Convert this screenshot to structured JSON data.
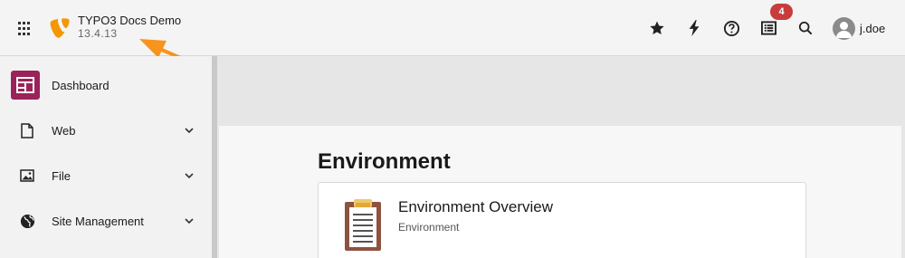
{
  "header": {
    "site_name": "TYPO3 Docs Demo",
    "site_version": "13.4.13",
    "notifications_count": "4",
    "username": "j.doe",
    "icons": [
      "apps-grid-icon",
      "typo3-logo-icon",
      "bookmark-star-icon",
      "flash-cache-icon",
      "help-icon",
      "system-information-icon",
      "search-icon",
      "avatar-icon"
    ]
  },
  "sidebar": {
    "items": [
      {
        "label": "Dashboard",
        "icon": "dashboard-icon",
        "expandable": false
      },
      {
        "label": "Web",
        "icon": "page-icon",
        "expandable": true
      },
      {
        "label": "File",
        "icon": "image-icon",
        "expandable": true
      },
      {
        "label": "Site Management",
        "icon": "globe-icon",
        "expandable": true
      }
    ]
  },
  "main": {
    "title": "Environment",
    "cards": [
      {
        "title": "Environment Overview",
        "subtitle": "Environment",
        "icon": "clipboard-icon"
      }
    ]
  },
  "colors": {
    "brand_orange": "#f49700",
    "dashboard_accent": "#9a2459",
    "badge_red": "#c83c3c",
    "annotation_arrow": "#f7941d"
  }
}
